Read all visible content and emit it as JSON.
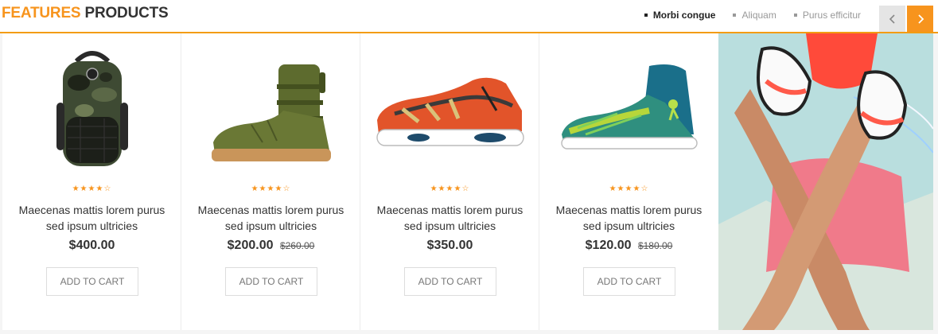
{
  "header": {
    "title_accent": "FEATURES",
    "title_rest": "PRODUCTS",
    "accent_color": "#f7941d",
    "tabs": [
      {
        "label": "Morbi congue",
        "active": true
      },
      {
        "label": "Aliquam",
        "active": false
      },
      {
        "label": "Purus efficitur",
        "active": false
      }
    ],
    "prev_icon": "chevron-left-icon",
    "next_icon": "chevron-right-icon"
  },
  "products": [
    {
      "name": "Maecenas mattis lorem purus sed ipsum ultricies",
      "price": "$400.00",
      "old_price": "",
      "rating": 4,
      "cart_label": "ADD TO CART",
      "image": "camo backpack"
    },
    {
      "name": "Maecenas mattis lorem purus sed ipsum ultricies",
      "price": "$200.00",
      "old_price": "$260.00",
      "rating": 4,
      "cart_label": "ADD TO CART",
      "image": "olive high-top boot"
    },
    {
      "name": "Maecenas mattis lorem purus sed ipsum ultricies",
      "price": "$350.00",
      "old_price": "",
      "rating": 4,
      "cart_label": "ADD TO CART",
      "image": "orange running shoe"
    },
    {
      "name": "Maecenas mattis lorem purus sed ipsum ultricies",
      "price": "$120.00",
      "old_price": "$180.00",
      "rating": 4,
      "cart_label": "ADD TO CART",
      "image": "teal basketball shoe"
    }
  ],
  "banner": {
    "image": "legs with sneakers photo"
  }
}
